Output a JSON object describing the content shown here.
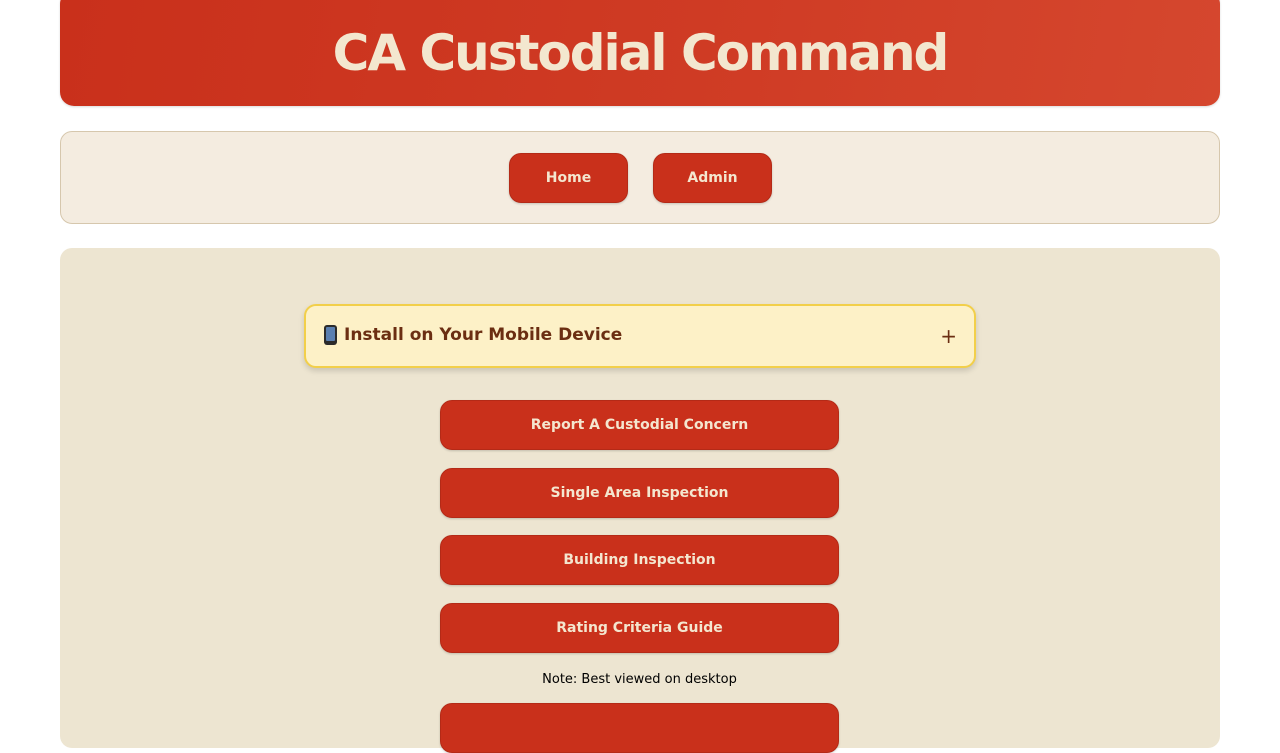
{
  "header": {
    "title": "CA Custodial Command"
  },
  "nav": {
    "home_label": "Home",
    "admin_label": "Admin"
  },
  "install_banner": {
    "icon": "mobile-phone-icon",
    "label": "Install on Your Mobile Device",
    "toggle_symbol": "+"
  },
  "actions": [
    {
      "label": "Report A Custodial Concern"
    },
    {
      "label": "Single Area Inspection"
    },
    {
      "label": "Building Inspection"
    },
    {
      "label": "Rating Criteria Guide"
    },
    {
      "label": ""
    }
  ],
  "note": "Note: Best viewed on desktop",
  "colors": {
    "primary": "#c9301b",
    "button_text": "#f4e6cf",
    "nav_background": "#f4ece0",
    "main_background": "#ede5d1",
    "banner_background": "#fdf1c7",
    "banner_border": "#f2cf4a",
    "banner_text": "#6b2e12"
  }
}
